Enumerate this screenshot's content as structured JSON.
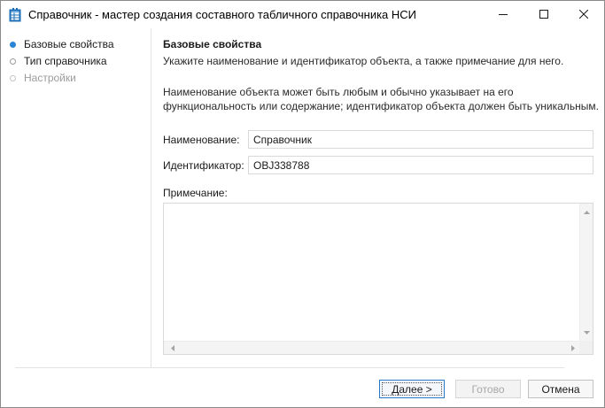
{
  "window": {
    "title": "Справочник - мастер создания составного табличного справочника НСИ",
    "icon": "table-book-icon"
  },
  "nav": {
    "items": [
      {
        "label": "Базовые свойства",
        "state": "active"
      },
      {
        "label": "Тип справочника",
        "state": "pending"
      },
      {
        "label": "Настройки",
        "state": "disabled"
      }
    ]
  },
  "main": {
    "title": "Базовые свойства",
    "subtitle": "Укажите наименование и идентификатор объекта, а также примечание для него.",
    "description": "Наименование объекта может быть любым и обычно указывает на его функциональность или содержание; идентификатор объекта должен быть уникальным.",
    "name_label": "Наименование:",
    "name_value": "Справочник",
    "id_label": "Идентификатор:",
    "id_value": "OBJ338788",
    "note_label": "Примечание:",
    "note_value": ""
  },
  "footer": {
    "next_label": "Далее >",
    "done_label": "Готово",
    "cancel_label": "Отмена"
  },
  "colors": {
    "accent": "#2a86d5",
    "disabled_text": "#9b9b9b"
  }
}
